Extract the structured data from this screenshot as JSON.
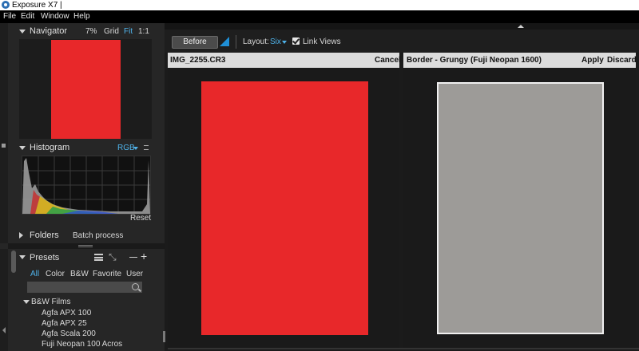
{
  "window": {
    "title": "Exposure X7 |"
  },
  "menu": [
    "File",
    "Edit",
    "Window",
    "Help"
  ],
  "navigator": {
    "title": "Navigator",
    "zoom_pct": "7%",
    "grid": "Grid",
    "fit": "Fit",
    "one_to_one": "1:1",
    "image_color": "#e8282a"
  },
  "histogram": {
    "title": "Histogram",
    "channel": "RGB",
    "reset": "Reset"
  },
  "folders": {
    "title": "Folders",
    "batch": "Batch process"
  },
  "presets": {
    "title": "Presets",
    "tabs": [
      "All",
      "Color",
      "B&W",
      "Favorite",
      "User"
    ],
    "active_tab": "All",
    "search_placeholder": "",
    "group": "B&W Films",
    "items": [
      "Agfa APX 100",
      "Agfa APX 25",
      "Agfa Scala 200",
      "Fuji Neopan 100 Acros"
    ]
  },
  "toolbar": {
    "before": "Before",
    "layout_label": "Layout:",
    "layout_value": "Six",
    "link_views": "Link Views",
    "link_checked": true
  },
  "left_view": {
    "file": "IMG_2255.CR3",
    "cancel": "Cancel",
    "image_color": "#e8282a"
  },
  "right_view": {
    "preset": "Border - Grungy (Fuji Neopan 1600)",
    "apply": "Apply",
    "discard": "Discard",
    "image_color": "#9d9b98"
  },
  "colors": {
    "accent": "#4fb3ea",
    "panel": "#262626",
    "header": "#dcdcdc"
  }
}
